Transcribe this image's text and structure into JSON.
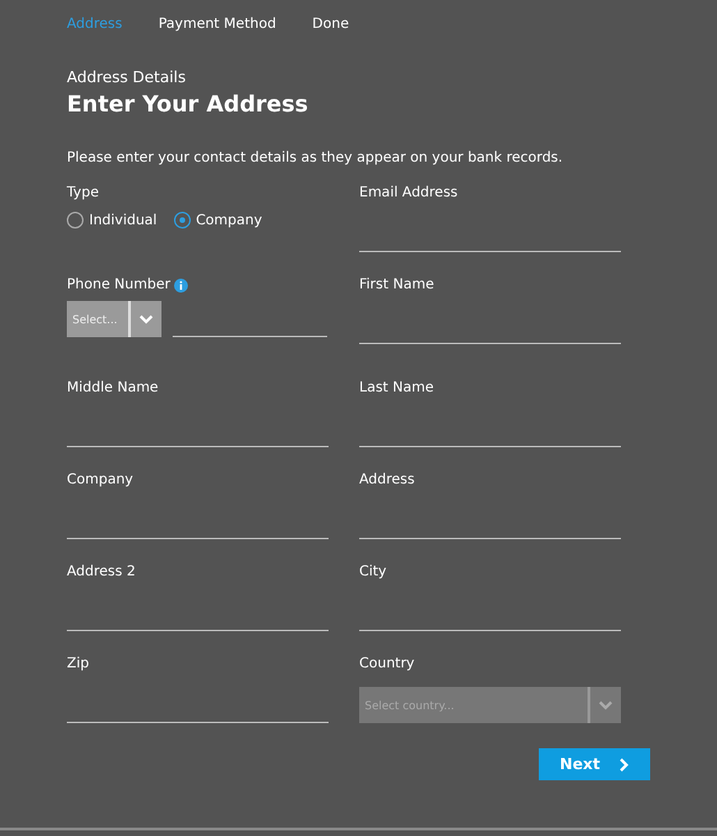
{
  "steps": [
    {
      "label": "Address",
      "selected": true
    },
    {
      "label": "Payment Method",
      "selected": false
    },
    {
      "label": "Done",
      "selected": false
    }
  ],
  "subtitle": "Address Details",
  "title": "Enter Your Address",
  "intro": "Please enter your contact details as they appear on your bank records.",
  "fields": [
    {
      "kind": "radio",
      "label": "Type",
      "options": [
        {
          "label": "Individual",
          "selected": false
        },
        {
          "label": "Company",
          "selected": true
        }
      ]
    },
    {
      "kind": "text",
      "label": "Email Address"
    },
    {
      "kind": "phone",
      "label": "Phone Number",
      "select": "Select..."
    },
    {
      "kind": "text",
      "label": "First Name"
    },
    {
      "kind": "text",
      "label": "Middle Name"
    },
    {
      "kind": "text",
      "label": "Last Name"
    },
    {
      "kind": "text",
      "label": "Company"
    },
    {
      "kind": "text",
      "label": "Address"
    },
    {
      "kind": "text",
      "label": "Address 2"
    },
    {
      "kind": "text",
      "label": "City"
    },
    {
      "kind": "text",
      "label": "Zip"
    },
    {
      "kind": "select",
      "label": "Country",
      "placeholder": "Select country..."
    }
  ],
  "next_button": "Next"
}
